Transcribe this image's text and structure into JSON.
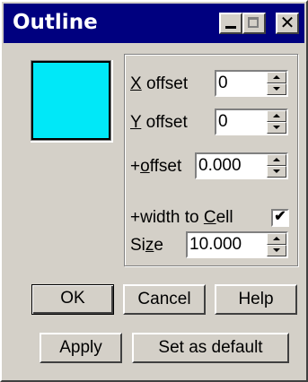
{
  "window": {
    "title": "Outline"
  },
  "titlebar": {
    "minimize": "minimize-icon",
    "maximize": "maximize-icon",
    "close_glyph": "✕"
  },
  "swatch": {
    "color": "#00e8f8"
  },
  "fields": {
    "x_offset": {
      "label_u": "X",
      "label_rest": " offset",
      "value": "0"
    },
    "y_offset": {
      "label_u": "Y",
      "label_rest": " offset",
      "value": "0"
    },
    "plus_offset": {
      "label_pre": "+",
      "label_u": "o",
      "label_rest": "ffset",
      "value": "0.000"
    },
    "width_to_cell": {
      "label_pre": "+width to ",
      "label_u": "C",
      "label_rest": "ell",
      "checked_glyph": "✔"
    },
    "size": {
      "label_pre": "Si",
      "label_u": "z",
      "label_rest": "e",
      "value": "10.000"
    }
  },
  "buttons": {
    "ok": "OK",
    "cancel": "Cancel",
    "help": "Help",
    "apply": "Apply",
    "set_default": "Set as default"
  }
}
